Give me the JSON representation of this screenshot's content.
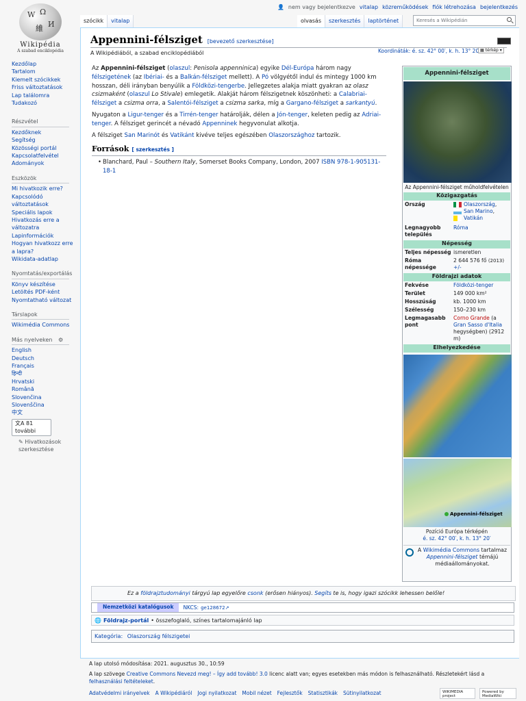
{
  "logo": {
    "wordmark": "Wikipédia",
    "tagline": "A szabad enciklopédia"
  },
  "personal": {
    "not_logged": "nem vagy bejelentkezve",
    "links": [
      "vitalap",
      "közreműködések",
      "fiók létrehozása",
      "bejelentkezés"
    ]
  },
  "tabs": {
    "left": [
      "szócikk",
      "vitalap"
    ],
    "right": [
      "olvasás",
      "szerkesztés",
      "laptörténet"
    ]
  },
  "search": {
    "placeholder": "Keresés a Wikipédián"
  },
  "sidebar": {
    "nav": [
      "Kezdőlap",
      "Tartalom",
      "Kiemelt szócikkek",
      "Friss változtatások",
      "Lap találomra",
      "Tudakozó"
    ],
    "participation": {
      "heading": "Részvétel",
      "items": [
        "Kezdőknek",
        "Segítség",
        "Közösségi portál",
        "Kapcsolatfelvétel",
        "Adományok"
      ]
    },
    "tools": {
      "heading": "Eszközök",
      "items": [
        "Mi hivatkozik erre?",
        "Kapcsolódó változtatások",
        "Speciális lapok",
        "Hivatkozás erre a változatra",
        "Lapinformációk",
        "Hogyan hivatkozz erre a lapra?",
        "Wikidata-adatlap"
      ]
    },
    "print": {
      "heading": "Nyomtatás/exportálás",
      "items": [
        "Könyv készítése",
        "Letöltés PDF-ként",
        "Nyomtatható változat"
      ]
    },
    "projects": {
      "heading": "Társlapok",
      "items": [
        "Wikimédia Commons"
      ]
    },
    "languages": {
      "heading": "Más nyelveken",
      "items": [
        "English",
        "Deutsch",
        "Français",
        "हिन्दी",
        "Hrvatski",
        "Română",
        "Slovenčina",
        "Slovenščina",
        "中文"
      ],
      "more": "81 további",
      "edit": "Hivatkozások szerkesztése"
    }
  },
  "article": {
    "title": "Appennini-félsziget",
    "title_edit": "[bevezető szerkesztése]",
    "tagline": "A Wikipédiából, a szabad enciklopédiából",
    "coord_label": "Koordináták:",
    "coord_value": "é. sz. 42° 00′, k. h. 13° 20′",
    "map_button": "térkép",
    "sources_heading": "Források",
    "sources_edit": "[ szerkesztés ]",
    "reference": {
      "author": "Blanchard, Paul – ",
      "work": "Southern Italy",
      "rest": ", Somerset Books Company, London, 2007 ",
      "isbn": "ISBN 978-1-905131-18-1"
    }
  },
  "infobox": {
    "title": "Appennini-félsziget",
    "sat_caption": "Az Appennini-félsziget műholdfelvételen",
    "admin_heading": "Közigazgatás",
    "country_label": "Ország",
    "countries": [
      "Olaszország",
      "San Marino",
      "Vatikán"
    ],
    "largest_label": "Legnagyobb település",
    "largest_value": "Róma",
    "pop_heading": "Népesség",
    "total_pop_label": "Teljes népesség",
    "total_pop_value": "ismeretlen",
    "rome_pop_label": "Róma népessége",
    "rome_pop_value": "2 644 576 fő",
    "rome_pop_year": "(2013)",
    "rome_pop_delta": "+/-",
    "geo_heading": "Földrajzi adatok",
    "geo_rows": [
      {
        "k": "Fekvése",
        "v": "Földközi-tenger"
      },
      {
        "k": "Terület",
        "v": "149 000 km²"
      },
      {
        "k": "Hosszúság",
        "v": "kb. 1000 km"
      },
      {
        "k": "Szélesség",
        "v": "150–230 km"
      }
    ],
    "peak_label": "Legmagasabb pont",
    "peak_name": "Corno Grande",
    "peak_rest": " (a ",
    "peak_range": "Gran Sasso d'Italia",
    "peak_tail": " hegységben) (2912 m)",
    "loc_heading": "Elhelyezkedése",
    "map_pin": "Appennini-félsziget",
    "map_caption": "Pozíció Európa térképén",
    "map_coord": "é. sz. 42° 00′, k. h. 13° 20′",
    "commons_pre": "A ",
    "commons_link": "Wikimédia Commons",
    "commons_mid": " tartalmaz ",
    "commons_topic": "Appennini-félsziget",
    "commons_post": " témájú médiaállományokat."
  },
  "stub": {
    "pre": "Ez a ",
    "topic": "földrajztudományi",
    "mid": " tárgyú lap egyelőre ",
    "stub_link": "csonk",
    "mid2": " (erősen hiányos). ",
    "help": "Segíts",
    "post": " te is, hogy igazi szócikk lehessen belőle!"
  },
  "authority": {
    "label": "Nemzetközi katalógusok",
    "nkcs_label": "NKCS:",
    "nkcs_value": "ge128672"
  },
  "portal": {
    "name": "Földrajz-portál",
    "desc": " • összefoglaló, színes tartalomajánló lap"
  },
  "category": {
    "label": "Kategória:",
    "value": "Olaszország félszigetei"
  },
  "footer": {
    "modified": "A lap utolsó módosítása: 2021. augusztus 30., 10:59",
    "license_pre": "A lap szövege ",
    "license_link": "Creative Commons Nevezd meg! – Így add tovább! 3.0",
    "license_mid": " licenc alatt van; egyes esetekben más módon is felhasználható. Részletekért lásd a ",
    "license_terms": "felhasználási feltételeket",
    "license_end": ".",
    "links": [
      "Adatvédelmi irányelvek",
      "A Wikipédiáról",
      "Jogi nyilatkozat",
      "Mobil nézet",
      "Fejlesztők",
      "Statisztikák",
      "Sütinyilatkozat"
    ],
    "badge_wmf": "WIKIMEDIA project",
    "badge_mw": "Powered by MediaWiki"
  }
}
